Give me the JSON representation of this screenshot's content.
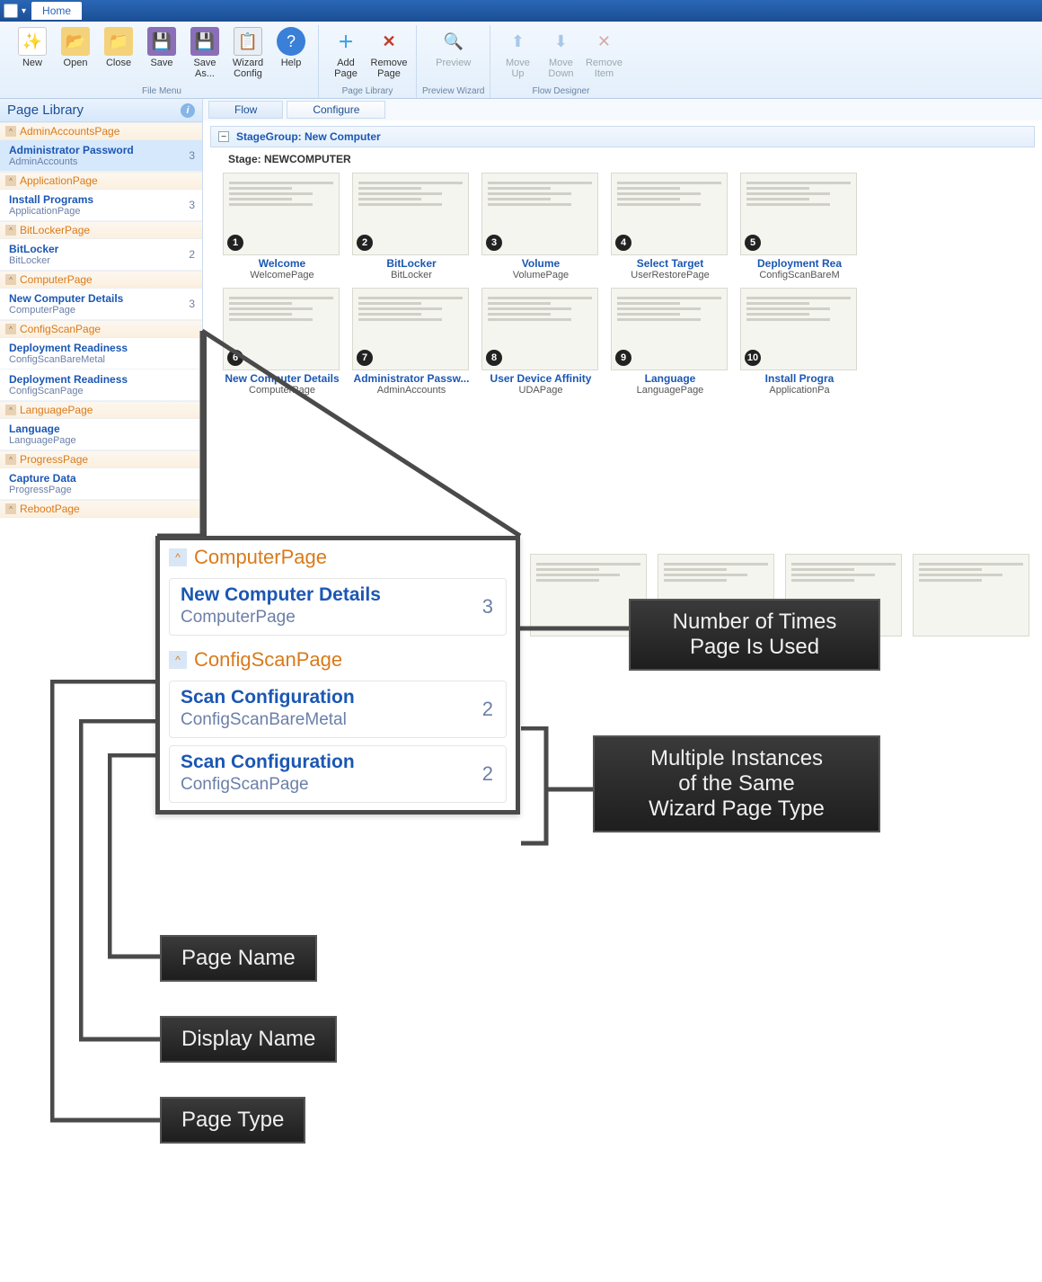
{
  "titlebar": {
    "tab": "Home"
  },
  "ribbon": {
    "groups": [
      {
        "label": "File Menu",
        "items": [
          {
            "name": "new",
            "label": "New",
            "icon": "📄"
          },
          {
            "name": "open",
            "label": "Open",
            "icon": "📂"
          },
          {
            "name": "close",
            "label": "Close",
            "icon": "📁"
          },
          {
            "name": "save",
            "label": "Save",
            "icon": "💾"
          },
          {
            "name": "saveas",
            "label": "Save\nAs...",
            "icon": "💾"
          },
          {
            "name": "wizcfg",
            "label": "Wizard\nConfig",
            "icon": "📋"
          },
          {
            "name": "help",
            "label": "Help",
            "icon": "❓"
          }
        ]
      },
      {
        "label": "Page Library",
        "items": [
          {
            "name": "addpage",
            "label": "Add\nPage",
            "icon": "➕"
          },
          {
            "name": "removepage",
            "label": "Remove\nPage",
            "icon": "✖"
          }
        ]
      },
      {
        "label": "Preview Wizard",
        "items": [
          {
            "name": "preview",
            "label": "Preview",
            "icon": "🔍",
            "disabled": true
          }
        ]
      },
      {
        "label": "Flow Designer",
        "items": [
          {
            "name": "moveup",
            "label": "Move\nUp",
            "icon": "⬆",
            "disabled": true
          },
          {
            "name": "movedown",
            "label": "Move\nDown",
            "icon": "⬇",
            "disabled": true
          },
          {
            "name": "removeitem",
            "label": "Remove\nItem",
            "icon": "✖",
            "disabled": true
          }
        ]
      }
    ]
  },
  "sidebar": {
    "title": "Page Library",
    "groups": [
      {
        "header": "AdminAccountsPage",
        "items": [
          {
            "display": "Administrator Password",
            "name": "AdminAccounts",
            "count": "3",
            "selected": true
          }
        ]
      },
      {
        "header": "ApplicationPage",
        "items": [
          {
            "display": "Install Programs",
            "name": "ApplicationPage",
            "count": "3"
          }
        ]
      },
      {
        "header": "BitLockerPage",
        "items": [
          {
            "display": "BitLocker",
            "name": "BitLocker",
            "count": "2"
          }
        ]
      },
      {
        "header": "ComputerPage",
        "items": [
          {
            "display": "New Computer Details",
            "name": "ComputerPage",
            "count": "3"
          }
        ]
      },
      {
        "header": "ConfigScanPage",
        "items": [
          {
            "display": "Deployment Readiness",
            "name": "ConfigScanBareMetal",
            "count": ""
          },
          {
            "display": "Deployment Readiness",
            "name": "ConfigScanPage",
            "count": ""
          }
        ]
      },
      {
        "header": "LanguagePage",
        "items": [
          {
            "display": "Language",
            "name": "LanguagePage",
            "count": ""
          }
        ]
      },
      {
        "header": "ProgressPage",
        "items": [
          {
            "display": "Capture Data",
            "name": "ProgressPage",
            "count": ""
          }
        ]
      },
      {
        "header": "RebootPage",
        "items": []
      }
    ]
  },
  "subtabs": {
    "flow": "Flow",
    "configure": "Configure"
  },
  "stagegroup": {
    "title": "StageGroup: New Computer",
    "stage": "Stage: NEWCOMPUTER"
  },
  "thumbs_row1": [
    {
      "num": "1",
      "title": "Welcome",
      "sub": "WelcomePage"
    },
    {
      "num": "2",
      "title": "BitLocker",
      "sub": "BitLocker"
    },
    {
      "num": "3",
      "title": "Volume",
      "sub": "VolumePage"
    },
    {
      "num": "4",
      "title": "Select Target",
      "sub": "UserRestorePage"
    },
    {
      "num": "5",
      "title": "Deployment Rea",
      "sub": "ConfigScanBareM"
    }
  ],
  "thumbs_row2": [
    {
      "num": "6",
      "title": "New Computer Details",
      "sub": "ComputerPage"
    },
    {
      "num": "7",
      "title": "Administrator Passw...",
      "sub": "AdminAccounts"
    },
    {
      "num": "8",
      "title": "User Device Affinity",
      "sub": "UDAPage"
    },
    {
      "num": "9",
      "title": "Language",
      "sub": "LanguagePage"
    },
    {
      "num": "10",
      "title": "Install Progra",
      "sub": "ApplicationPa"
    }
  ],
  "callout": {
    "group1": {
      "header": "ComputerPage",
      "items": [
        {
          "display": "New Computer Details",
          "name": "ComputerPage",
          "count": "3"
        }
      ]
    },
    "group2": {
      "header": "ConfigScanPage",
      "items": [
        {
          "display": "Scan Configuration",
          "name": "ConfigScanBareMetal",
          "count": "2"
        },
        {
          "display": "Scan Configuration",
          "name": "ConfigScanPage",
          "count": "2"
        }
      ]
    }
  },
  "annotations": {
    "count": "Number of Times\nPage Is Used",
    "multi": "Multiple Instances\nof the Same\nWizard Page Type",
    "pagename": "Page Name",
    "displayname": "Display Name",
    "pagetype": "Page Type"
  }
}
